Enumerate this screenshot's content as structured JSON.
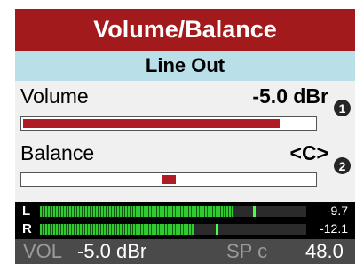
{
  "header": {
    "title": "Volume/Balance",
    "subtitle": "Line Out"
  },
  "volume": {
    "label": "Volume",
    "value": "-5.0 dBr",
    "bar_level": 0.88,
    "knob_number": "1"
  },
  "balance": {
    "label": "Balance",
    "value": "<C>",
    "position": 0.5,
    "knob_number": "2"
  },
  "meters": [
    {
      "channel": "L",
      "value": "-9.7",
      "level": 0.73,
      "peak": 0.8
    },
    {
      "channel": "R",
      "value": "-12.1",
      "level": 0.58,
      "peak": 0.66
    }
  ],
  "status": {
    "vol_label": "VOL",
    "vol_value": "-5.0 dBr",
    "sp_label": "SP c",
    "sp_value": "48.0"
  },
  "colors": {
    "title_bg": "#a31a1c",
    "subtitle_bg": "#b9e0e8",
    "bar_fill": "#b01c24",
    "meter_green": "#2ecc2e"
  }
}
